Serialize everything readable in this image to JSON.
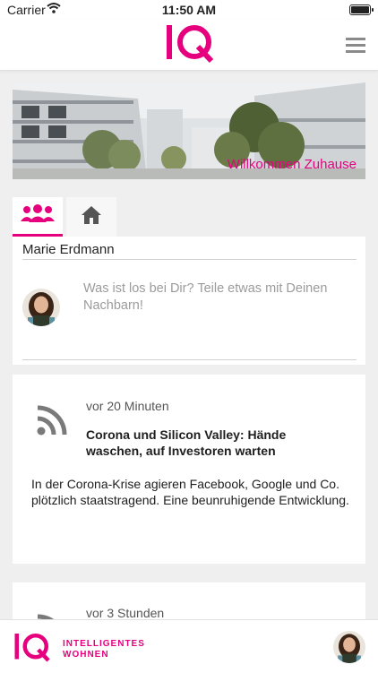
{
  "status_bar": {
    "carrier": "Carrier",
    "time": "11:50 AM"
  },
  "header": {
    "logo_text": "IQ",
    "menu_icon": "hamburger-icon"
  },
  "colors": {
    "brand": "#e6007e",
    "background": "#efefef",
    "icon_gray": "#8a8a8a"
  },
  "banner": {
    "text": "Willkommen Zuhause"
  },
  "tabs": [
    {
      "icon": "community-icon",
      "active": true
    },
    {
      "icon": "home-icon",
      "active": false
    }
  ],
  "composer": {
    "user_name": "Marie Erdmann",
    "prompt": "Was ist los bei Dir? Teile etwas mit Deinen Nachbarn!"
  },
  "feed": [
    {
      "icon": "rss-icon",
      "time": "vor 20 Minuten",
      "title": "Corona und Silicon Valley: Hände waschen, auf Investoren warten",
      "body": "In der Corona-Krise agieren Facebook, Google und Co. plötzlich staatstragend. Eine beunruhigende Entwicklung."
    },
    {
      "icon": "rss-icon",
      "time": "vor 3 Stunden"
    }
  ],
  "footer": {
    "brand_text_line1": "INTELLIGENTES",
    "brand_text_line2": "WOHNEN"
  }
}
